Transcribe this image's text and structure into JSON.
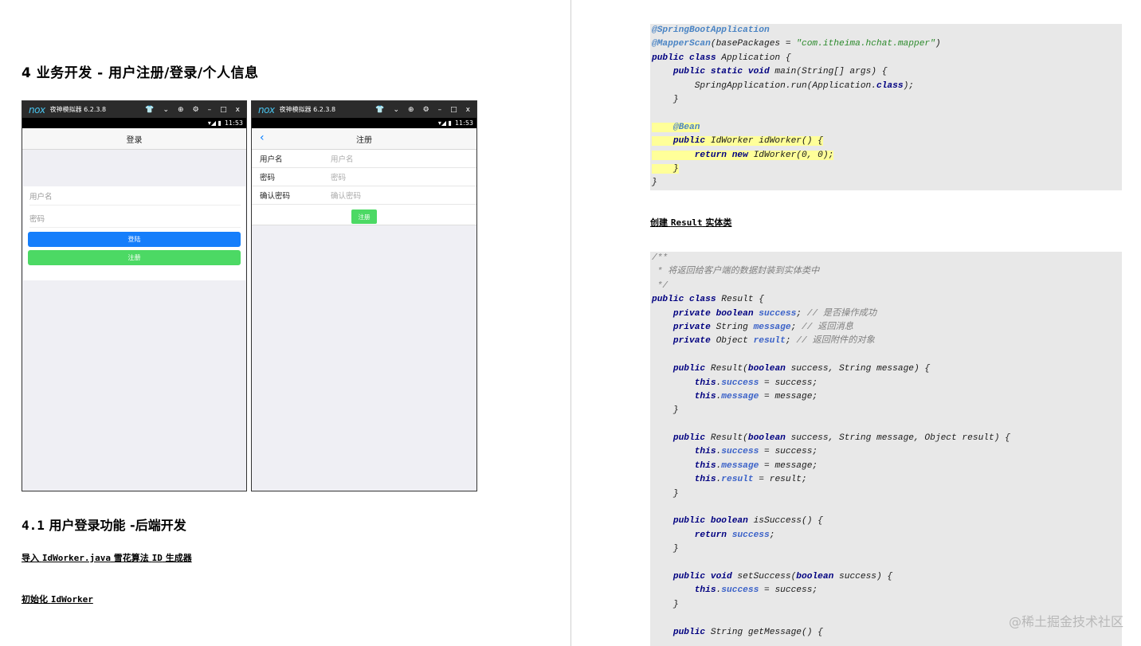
{
  "left_page": {
    "heading": "4   业务开发 - 用户注册/登录/个人信息",
    "section_num": "4.1",
    "section_title": "  用户登录功能  -后端开发",
    "sub1_pre": "导入 ",
    "sub1_code": "IdWorker.java",
    "sub1_mid": " 雪花算法 ",
    "sub1_code2": "ID",
    "sub1_post": " 生成器",
    "sub2_pre": "初始化 ",
    "sub2_code": "IdWorker"
  },
  "emulator": {
    "logo": "nox",
    "title": "夜神模拟器 6.2.3.8",
    "controls": [
      "👕",
      "⌄",
      "⊕",
      "⚙",
      "–",
      "□",
      "x"
    ],
    "status_icons": "▾◢ ▮",
    "time": "11:53"
  },
  "login_screen": {
    "title": "登录",
    "username_placeholder": "用户名",
    "password_placeholder": "密码",
    "login_button": "登陆",
    "register_button": "注册",
    "colors": {
      "login": "#157efb",
      "register": "#4cd964"
    }
  },
  "register_screen": {
    "back": "‹",
    "title": "注册",
    "rows": [
      {
        "label": "用户名",
        "placeholder": "用户名"
      },
      {
        "label": "密码",
        "placeholder": "密码"
      },
      {
        "label": "确认密码",
        "placeholder": "确认密码"
      }
    ],
    "submit_button": "注册"
  },
  "right_page": {
    "result_heading_pre": "创建 ",
    "result_heading_code": "Result",
    "result_heading_post": " 实体类"
  },
  "watermark": "@稀土掘金技术社区"
}
